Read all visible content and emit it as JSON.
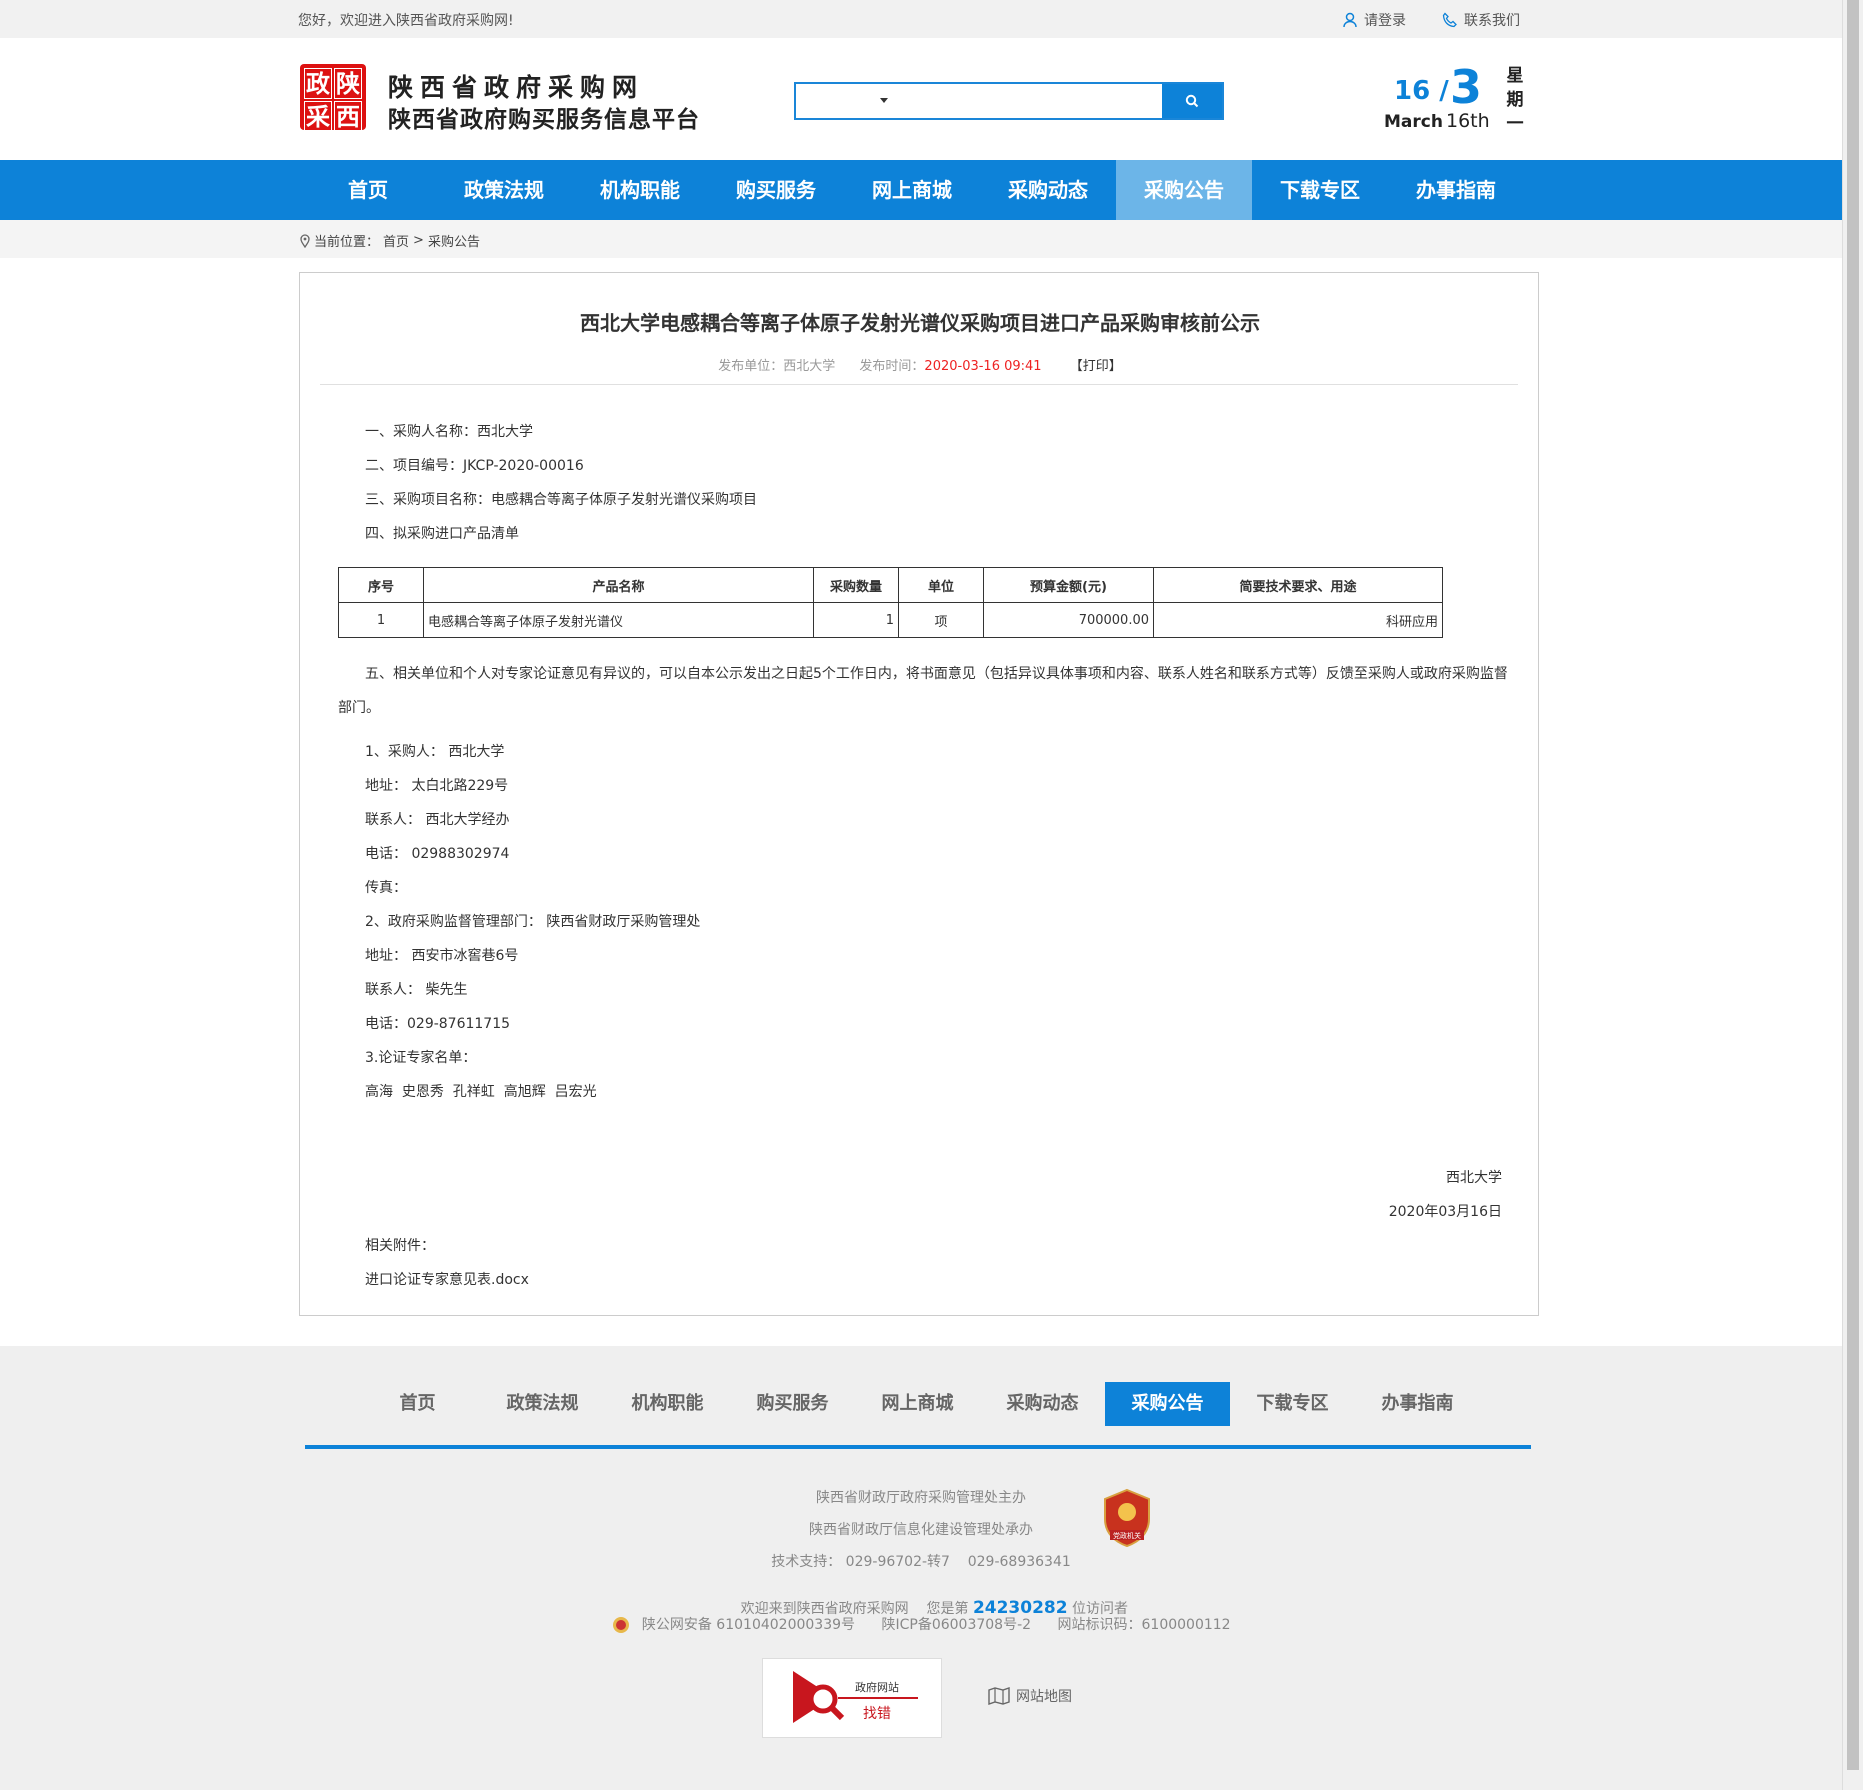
{
  "topbar": {
    "welcome": "您好，欢迎进入陕西省政府采购网!",
    "login": "请登录",
    "contact": "联系我们"
  },
  "header": {
    "logo_chars": [
      "政",
      "陕",
      "采",
      "西"
    ],
    "site_name": "陕西省政府采购网",
    "subtitle": "陕西省政府购买服务信息平台",
    "search_placeholder": "",
    "date_day": "16",
    "date_sep": "/",
    "date_month_num": "3",
    "date_month": "March",
    "date_dayth": "16th",
    "week": [
      "星",
      "期",
      "一"
    ]
  },
  "nav": {
    "items": [
      "首页",
      "政策法规",
      "机构职能",
      "购买服务",
      "网上商城",
      "采购动态",
      "采购公告",
      "下载专区",
      "办事指南"
    ],
    "active": "采购公告"
  },
  "breadcrumb": {
    "label": "当前位置：",
    "home": "首页",
    "sep": ">",
    "current": "采购公告"
  },
  "article": {
    "title": "西北大学电感耦合等离子体原子发射光谱仪采购项目进口产品采购审核前公示",
    "publisher_label": "发布单位：西北大学",
    "time_label": "发布时间：",
    "time": "2020-03-16 09:41",
    "print": "【打印】",
    "l1": "一、采购人名称：西北大学",
    "l2": "二、项目编号：JKCP-2020-00016",
    "l3": "三、采购项目名称：电感耦合等离子体原子发射光谱仪采购项目",
    "l4": "四、拟采购进口产品清单",
    "table": {
      "headers": [
        "序号",
        "产品名称",
        "采购数量",
        "单位",
        "预算金额(元)",
        "简要技术要求、用途"
      ],
      "rows": [
        [
          "1",
          "电感耦合等离子体原子发射光谱仪",
          "1",
          "项",
          "700000.00",
          "科研应用"
        ]
      ]
    },
    "p5": "五、相关单位和个人对专家论证意见有异议的，可以自本公示发出之日起5个工作日内，将书面意见（包括异议具体事项和内容、联系人姓名和联系方式等）反馈至采购人或政府采购监督部门。",
    "c1": "1、采购人： 西北大学",
    "c2": "地址： 太白北路229号",
    "c3": "联系人： 西北大学经办",
    "c4": "电话： 02988302974",
    "c5": "传真：",
    "c6": "2、政府采购监督管理部门： 陕西省财政厅采购管理处",
    "c7": "地址： 西安市冰窖巷6号",
    "c8": "联系人： 柴先生",
    "c9": "电话：029-87611715",
    "c10": "3.论证专家名单：",
    "c11": "高海  史恩秀  孔祥虹  高旭辉  吕宏光",
    "sign_org": "西北大学",
    "sign_date": "2020年03月16日",
    "attach_label": "相关附件：",
    "attach_file": "进口论证专家意见表.docx"
  },
  "footer": {
    "nav": [
      "首页",
      "政策法规",
      "机构职能",
      "购买服务",
      "网上商城",
      "采购动态",
      "采购公告",
      "下载专区",
      "办事指南"
    ],
    "host": "陕西省财政厅政府采购管理处主办",
    "undertake": "陕西省财政厅信息化建设管理处承办",
    "support": "技术支持： 029-96702-转7    029-68936341",
    "visit_pre": "欢迎来到陕西省政府采购网    您是第",
    "visit_num": "24230282",
    "visit_post": "位访问者",
    "police": "陕公网安备 61010402000339号",
    "icp": "陕ICP备06003708号-2",
    "siteid": "网站标识码：6100000112",
    "badge_text": "党政机关",
    "report_l1": "政府网站",
    "report_l2": "找错",
    "sitemap": "网站地图"
  },
  "colors": {
    "primary": "#0d82d8",
    "nav_active": "#6cb5e8",
    "logo": "#dd1111",
    "time": "#ee2222"
  }
}
